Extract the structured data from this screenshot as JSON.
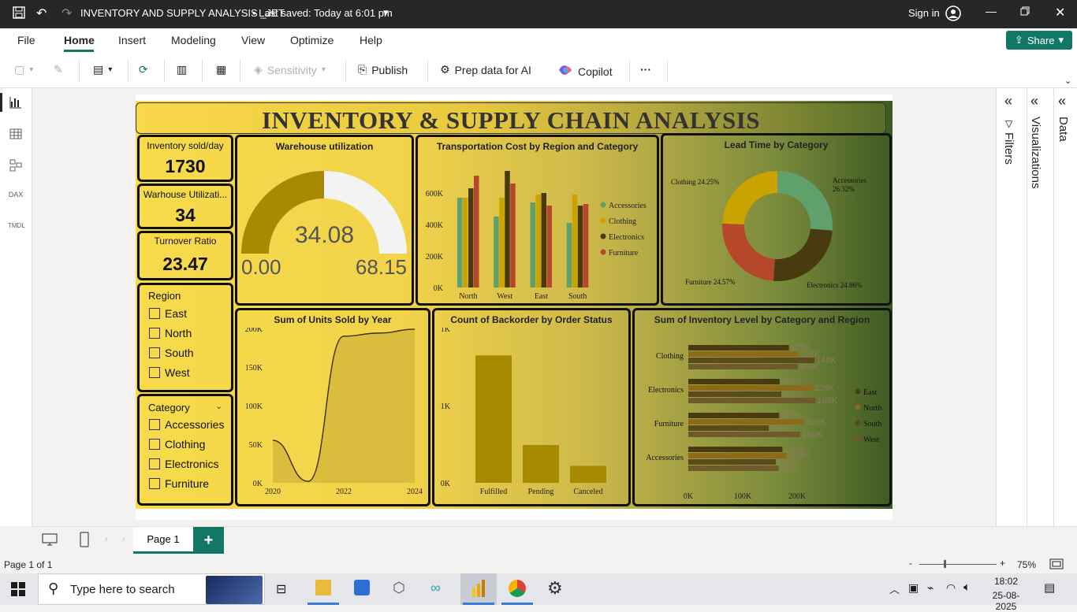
{
  "titlebar": {
    "title": "INVENTORY AND SUPPLY ANALYSIS _JET",
    "saved": "• Last saved: Today at 6:01 pm",
    "signin": "Sign in"
  },
  "ribbon_tabs": [
    "File",
    "Home",
    "Insert",
    "Modeling",
    "View",
    "Optimize",
    "Help"
  ],
  "share_label": "Share",
  "toolbar": {
    "sensitivity": "Sensitivity",
    "publish": "Publish",
    "prep": "Prep data for AI",
    "copilot": "Copilot",
    "more": "···"
  },
  "rpanes": {
    "filters": "Filters",
    "visualizations": "Visualizations",
    "data": "Data"
  },
  "report": {
    "title": "INVENTORY & SUPPLY CHAIN ANALYSIS",
    "kpis": [
      {
        "label": "Inventory sold/day",
        "value": "1730"
      },
      {
        "label": "Warhouse Utilizati...",
        "value": "34"
      },
      {
        "label": "Turnover Ratio",
        "value": "23.47"
      }
    ],
    "region_slicer": {
      "title": "Region",
      "items": [
        "East",
        "North",
        "South",
        "West"
      ]
    },
    "category_slicer": {
      "title": "Category",
      "items": [
        "Accessories",
        "Clothing",
        "Electronics",
        "Furniture"
      ]
    },
    "gauge": {
      "title": "Warehouse utilization",
      "value": "34.08",
      "min": "0.00",
      "max": "68.15",
      "fill": 0.5
    },
    "transport": {
      "title": "Transportation Cost by Region and Category"
    },
    "leadtime": {
      "title": "Lead Time by Category"
    },
    "units": {
      "title": "Sum of Units Sold by Year"
    },
    "backorder": {
      "title": "Count of Backorder by Order Status"
    },
    "inventory": {
      "title": "Sum of Inventory Level by Category and Region"
    }
  },
  "chart_data": [
    {
      "type": "bar",
      "title": "Transportation Cost by Region and Category",
      "categories": [
        "North",
        "West",
        "East",
        "South"
      ],
      "yticks": [
        "0K",
        "200K",
        "400K",
        "600K"
      ],
      "ylim": [
        0,
        750000
      ],
      "series": [
        {
          "name": "Accessories",
          "color": "#5fa06b",
          "values": [
            570000,
            450000,
            540000,
            410000
          ]
        },
        {
          "name": "Clothing",
          "color": "#c9a300",
          "values": [
            570000,
            570000,
            590000,
            590000
          ]
        },
        {
          "name": "Electronics",
          "color": "#4a3a10",
          "values": [
            630000,
            740000,
            600000,
            520000
          ]
        },
        {
          "name": "Furniture",
          "color": "#b5472a",
          "values": [
            710000,
            660000,
            520000,
            530000
          ]
        }
      ],
      "legend": "right"
    },
    {
      "type": "pie",
      "title": "Lead Time by Category",
      "slices": [
        {
          "name": "Accessories",
          "pct": 26.32,
          "color": "#5fa06b",
          "label": "Accessories 26.32%"
        },
        {
          "name": "Electronics",
          "pct": 24.86,
          "color": "#4a3a10",
          "label": "Electronics 24.86%"
        },
        {
          "name": "Furniture",
          "pct": 24.57,
          "color": "#b5472a",
          "label": "Furniture 24.57%"
        },
        {
          "name": "Clothing",
          "pct": 24.25,
          "color": "#c9a300",
          "label": "Clothing 24.25%"
        }
      ]
    },
    {
      "type": "area",
      "title": "Sum of Units Sold by Year",
      "x": [
        2020,
        2021,
        2022,
        2023,
        2024
      ],
      "y": [
        55000,
        2000,
        190000,
        194000,
        199000
      ],
      "xticks": [
        "2020",
        "2022",
        "2024"
      ],
      "yticks": [
        "0K",
        "50K",
        "100K",
        "150K",
        "200K"
      ],
      "ylim": [
        0,
        200000
      ]
    },
    {
      "type": "bar",
      "title": "Count of Backorder by Order Status",
      "categories": [
        "Fulfilled",
        "Pending",
        "Canceled"
      ],
      "values": [
        1650,
        490,
        220
      ],
      "yticks": [
        "0K",
        "1K",
        "1K"
      ],
      "ylim": [
        0,
        2000
      ],
      "color": "#a88a00"
    },
    {
      "type": "bar",
      "title": "Sum of Inventory Level by Category and Region",
      "categories": [
        "Clothing",
        "Electronics",
        "Furniture",
        "Accessories"
      ],
      "xticks": [
        "0K",
        "100K",
        "200K"
      ],
      "xlim": [
        0,
        200000
      ],
      "series": [
        {
          "name": "East",
          "color": "#4a3a10",
          "values": [
            185000,
            168000,
            167000,
            173000
          ],
          "labels": [
            "185K",
            "168K",
            "167K",
            "173K"
          ]
        },
        {
          "name": "North",
          "color": "#8c6a1a",
          "values": [
            202000,
            228000,
            213000,
            181000
          ],
          "labels": [
            "202K",
            "228K",
            "213K",
            "181K"
          ]
        },
        {
          "name": "South",
          "color": "#5b4a1c",
          "values": [
            232000,
            171000,
            148000,
            161000
          ],
          "labels": [
            "232K",
            "171K",
            "148K",
            "161K"
          ]
        },
        {
          "name": "West",
          "color": "#6e5a2a",
          "values": [
            201000,
            234000,
            206000,
            166000
          ],
          "labels": [
            "201K",
            "234K",
            "206K",
            "166K"
          ]
        }
      ],
      "legend": "right"
    }
  ],
  "pagebar": {
    "page1": "Page 1",
    "add": "+"
  },
  "status": {
    "page": "Page 1 of 1",
    "zoom": "75%"
  },
  "taskbar": {
    "search": "Type here to search",
    "time": "18:02",
    "date": "25-08-2025"
  }
}
